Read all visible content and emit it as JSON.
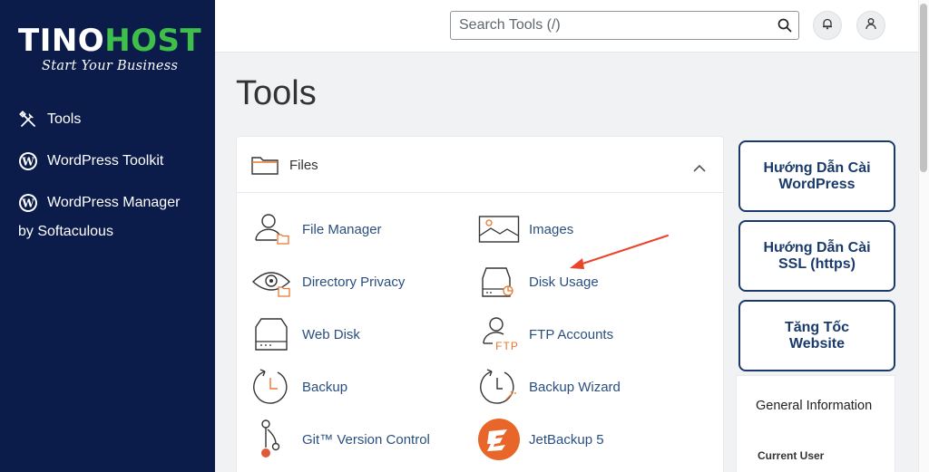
{
  "brand": {
    "name_part1": "TINO",
    "name_part2": "HOST",
    "tagline": "Start Your Business",
    "colors": {
      "sidebar": "#0b1b4a",
      "accent_green": "#3fbf4a",
      "link": "#2a4f7f",
      "promo_border": "#1a3a6b"
    }
  },
  "sidebar": {
    "items": [
      {
        "label": "Tools",
        "icon": "tools-icon"
      },
      {
        "label": "WordPress Toolkit",
        "icon": "wordpress-icon"
      },
      {
        "label": "WordPress Manager",
        "icon": "wordpress-icon"
      }
    ],
    "sub_label": "by Softaculous"
  },
  "header": {
    "search_placeholder": "Search Tools (/)",
    "icons": [
      "search-icon",
      "bell-icon",
      "user-icon"
    ]
  },
  "page": {
    "title": "Tools"
  },
  "files_panel": {
    "title": "Files",
    "icon": "folder-icon",
    "tools": [
      {
        "label": "File Manager",
        "icon": "file-manager-icon"
      },
      {
        "label": "Images",
        "icon": "images-icon"
      },
      {
        "label": "Directory Privacy",
        "icon": "directory-privacy-icon"
      },
      {
        "label": "Disk Usage",
        "icon": "disk-usage-icon"
      },
      {
        "label": "Web Disk",
        "icon": "web-disk-icon"
      },
      {
        "label": "FTP Accounts",
        "icon": "ftp-accounts-icon"
      },
      {
        "label": "Backup",
        "icon": "backup-icon"
      },
      {
        "label": "Backup Wizard",
        "icon": "backup-wizard-icon"
      },
      {
        "label": "Git™ Version Control",
        "icon": "git-icon"
      },
      {
        "label": "JetBackup 5",
        "icon": "jetbackup-icon"
      }
    ],
    "ftp_icon_text": "FTP"
  },
  "promos": [
    {
      "line1": "Hướng Dẫn Cài",
      "line2": "WordPress"
    },
    {
      "line1": "Hướng Dẫn Cài",
      "line2": "SSL (https)"
    },
    {
      "line1": "Tăng Tốc",
      "line2": "Website"
    }
  ],
  "general_info": {
    "title": "General Information",
    "current_user_label": "Current User"
  }
}
